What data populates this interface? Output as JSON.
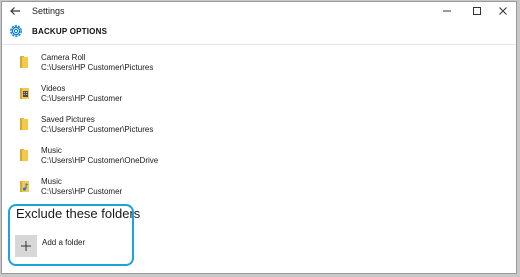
{
  "window": {
    "title": "Settings"
  },
  "header": {
    "title": "BACKUP OPTIONS"
  },
  "folders": [
    {
      "name": "Camera Roll",
      "path": "C:\\Users\\HP Customer\\Pictures",
      "icon": "folder-icon"
    },
    {
      "name": "Videos",
      "path": "C:\\Users\\HP Customer",
      "icon": "videos-folder-icon"
    },
    {
      "name": "Saved Pictures",
      "path": "C:\\Users\\HP Customer\\Pictures",
      "icon": "folder-icon"
    },
    {
      "name": "Music",
      "path": "C:\\Users\\HP Customer\\OneDrive",
      "icon": "folder-icon"
    },
    {
      "name": "Music",
      "path": "C:\\Users\\HP Customer",
      "icon": "music-folder-icon"
    }
  ],
  "exclude": {
    "title": "Exclude these folders",
    "add_label": "Add a folder"
  },
  "colors": {
    "accent": "#0078d7",
    "highlight": "#1ea3d6",
    "folder": "#f2c94c"
  }
}
